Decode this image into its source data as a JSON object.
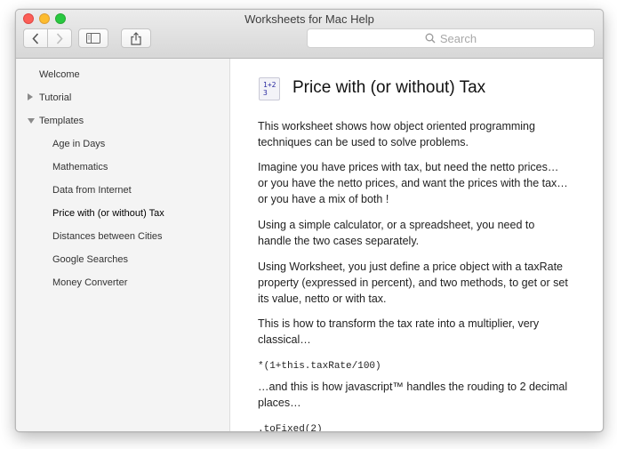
{
  "window": {
    "title": "Worksheets for Mac Help"
  },
  "toolbar": {
    "back_icon": "chevron-left-icon",
    "forward_icon": "chevron-right-icon",
    "sidebar_icon": "sidebar-icon",
    "share_icon": "share-icon"
  },
  "search": {
    "placeholder": "Search",
    "icon": "magnifier-icon"
  },
  "sidebar": {
    "items": [
      {
        "label": "Welcome"
      },
      {
        "label": "Tutorial",
        "disclosure": "collapsed"
      },
      {
        "label": "Templates",
        "disclosure": "expanded"
      },
      {
        "label": "Age in Days"
      },
      {
        "label": "Mathematics"
      },
      {
        "label": "Data from Internet"
      },
      {
        "label": "Price with (or without) Tax",
        "selected": true
      },
      {
        "label": "Distances between Cities"
      },
      {
        "label": "Google Searches"
      },
      {
        "label": "Money Converter"
      }
    ]
  },
  "article": {
    "icon_text": [
      "1+2",
      "3"
    ],
    "title": "Price with (or without) Tax",
    "paragraphs": [
      "This worksheet shows how object oriented programming techniques can be used to solve problems.",
      "Imagine you have prices with tax, but need the netto prices… or you have the netto prices, and want the prices with the tax…  or you have a mix of both !",
      "Using a simple calculator, or a spreadsheet, you need to handle the two cases separately.",
      "Using Worksheet, you just define a price object with a taxRate property (expressed in percent), and two methods, to get or set its value, netto or with tax.",
      "This is how to transform the tax rate into a multiplier, very classical…",
      "…and this is how javascript™ handles the rouding to 2 decimal places…"
    ],
    "code": [
      "*(1+this.taxRate/100)",
      ".toFixed(2)"
    ]
  },
  "colors": {
    "close": "#fc5f57",
    "minimize": "#fdbc2e",
    "maximize": "#28c840",
    "sidebar_bg": "#f4f4f4"
  }
}
